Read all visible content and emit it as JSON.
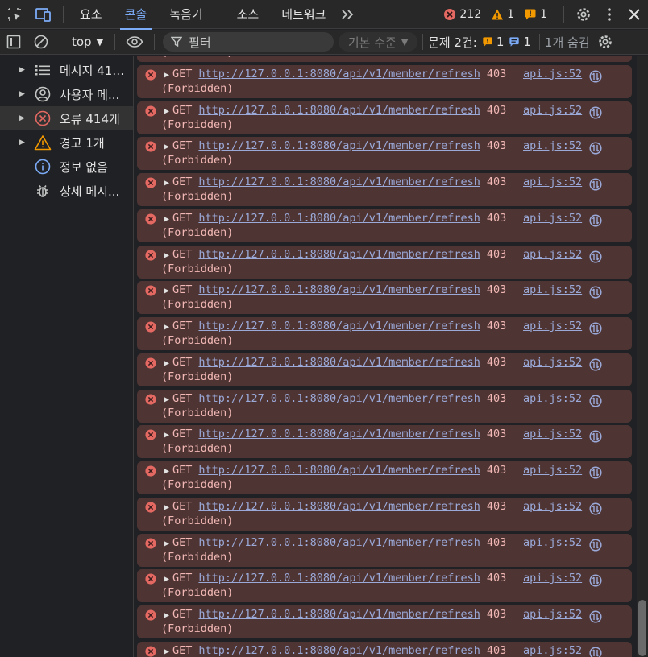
{
  "tabs": [
    {
      "label": "요소"
    },
    {
      "label": "콘솔"
    },
    {
      "label": "녹음기"
    },
    {
      "label": "소스"
    },
    {
      "label": "네트워크"
    }
  ],
  "counts": {
    "errors": "212",
    "warnings": "1",
    "info": "1"
  },
  "toolbar": {
    "context": "top",
    "filter_placeholder": "필터",
    "level": "기본 수준",
    "issues_label": "문제 2건:",
    "issues_warn": "1",
    "issues_info": "1",
    "hidden": "1개 숨김"
  },
  "sidebar": {
    "items": [
      {
        "label": "메시지 415...",
        "icon": "list-icon"
      },
      {
        "label": "사용자 메...",
        "icon": "user-icon"
      },
      {
        "label": "오류 414개",
        "icon": "error-icon"
      },
      {
        "label": "경고 1개",
        "icon": "warning-icon"
      },
      {
        "label": "정보 없음",
        "icon": "info-icon"
      },
      {
        "label": "상세 메시...",
        "icon": "bug-icon"
      }
    ]
  },
  "messages": [
    {
      "method": "GET",
      "url": "http://127.0.0.1:8080/api/v1/member/refresh",
      "status": "403",
      "status_text": "(Forbidden)",
      "source": "api.js:52"
    },
    {
      "method": "GET",
      "url": "http://127.0.0.1:8080/api/v1/member/refresh",
      "status": "403",
      "status_text": "(Forbidden)",
      "source": "api.js:52"
    },
    {
      "method": "GET",
      "url": "http://127.0.0.1:8080/api/v1/member/refresh",
      "status": "403",
      "status_text": "(Forbidden)",
      "source": "api.js:52"
    },
    {
      "method": "GET",
      "url": "http://127.0.0.1:8080/api/v1/member/refresh",
      "status": "403",
      "status_text": "(Forbidden)",
      "source": "api.js:52"
    },
    {
      "method": "GET",
      "url": "http://127.0.0.1:8080/api/v1/member/refresh",
      "status": "403",
      "status_text": "(Forbidden)",
      "source": "api.js:52"
    },
    {
      "method": "GET",
      "url": "http://127.0.0.1:8080/api/v1/member/refresh",
      "status": "403",
      "status_text": "(Forbidden)",
      "source": "api.js:52"
    },
    {
      "method": "GET",
      "url": "http://127.0.0.1:8080/api/v1/member/refresh",
      "status": "403",
      "status_text": "(Forbidden)",
      "source": "api.js:52"
    },
    {
      "method": "GET",
      "url": "http://127.0.0.1:8080/api/v1/member/refresh",
      "status": "403",
      "status_text": "(Forbidden)",
      "source": "api.js:52"
    },
    {
      "method": "GET",
      "url": "http://127.0.0.1:8080/api/v1/member/refresh",
      "status": "403",
      "status_text": "(Forbidden)",
      "source": "api.js:52"
    },
    {
      "method": "GET",
      "url": "http://127.0.0.1:8080/api/v1/member/refresh",
      "status": "403",
      "status_text": "(Forbidden)",
      "source": "api.js:52"
    },
    {
      "method": "GET",
      "url": "http://127.0.0.1:8080/api/v1/member/refresh",
      "status": "403",
      "status_text": "(Forbidden)",
      "source": "api.js:52"
    },
    {
      "method": "GET",
      "url": "http://127.0.0.1:8080/api/v1/member/refresh",
      "status": "403",
      "status_text": "(Forbidden)",
      "source": "api.js:52"
    },
    {
      "method": "GET",
      "url": "http://127.0.0.1:8080/api/v1/member/refresh",
      "status": "403",
      "status_text": "(Forbidden)",
      "source": "api.js:52"
    },
    {
      "method": "GET",
      "url": "http://127.0.0.1:8080/api/v1/member/refresh",
      "status": "403",
      "status_text": "(Forbidden)",
      "source": "api.js:52"
    },
    {
      "method": "GET",
      "url": "http://127.0.0.1:8080/api/v1/member/refresh",
      "status": "403",
      "status_text": "(Forbidden)",
      "source": "api.js:52"
    },
    {
      "method": "GET",
      "url": "http://127.0.0.1:8080/api/v1/member/refresh",
      "status": "403",
      "status_text": "(Forbidden)",
      "source": "api.js:52"
    },
    {
      "method": "GET",
      "url": "http://127.0.0.1:8080/api/v1/member/refresh",
      "status": "403",
      "status_text": "(Forbidden)",
      "source": "api.js:52"
    },
    {
      "method": "GET",
      "url": "http://127.0.0.1:8080/api/v1/member/refresh",
      "status": "403",
      "status_text": "(Forbidden)",
      "source": "api.js:52"
    }
  ],
  "colors": {
    "background": "#202124",
    "error_row": "#4e3534",
    "error_text": "#f2b8b5",
    "link": "#9ba9d9",
    "accent": "#7cacf8",
    "error_icon": "#e46962",
    "warning_icon": "#f29900"
  }
}
